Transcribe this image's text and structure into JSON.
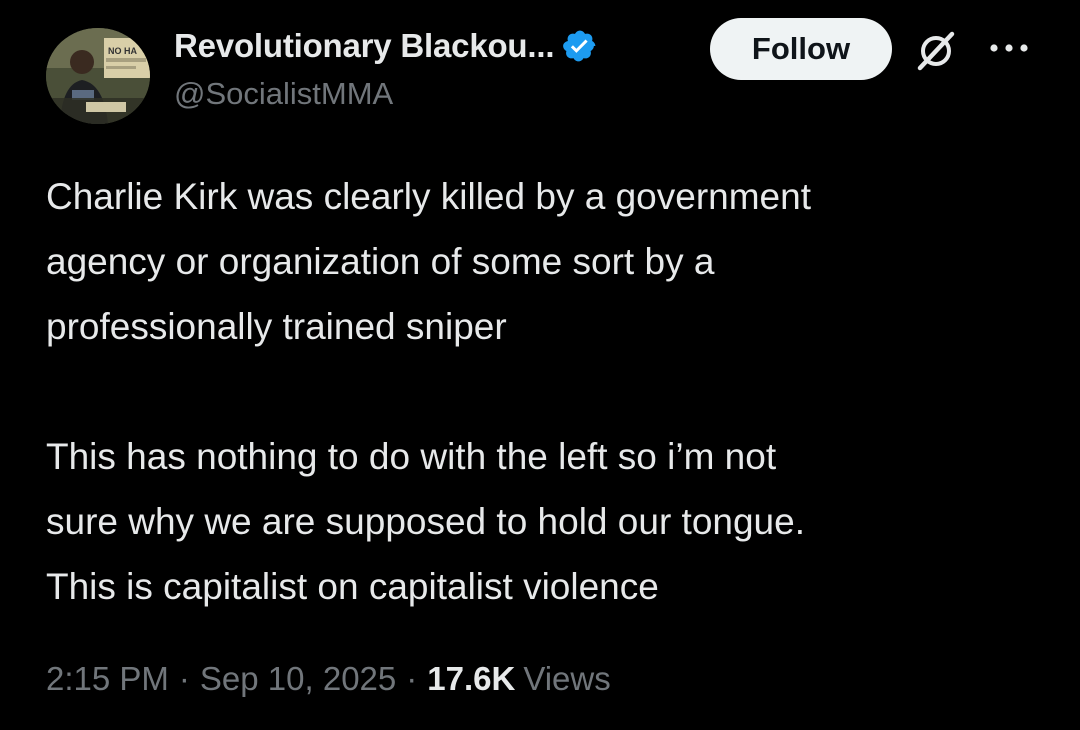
{
  "author": {
    "display_name": "Revolutionary Blackou...",
    "handle": "@SocialistMMA",
    "verified": true,
    "avatar_sign_text": "NO HA"
  },
  "actions": {
    "follow_label": "Follow",
    "grok_icon": "grok-icon",
    "more_icon": "more-icon"
  },
  "tweet": {
    "paragraph_1": "Charlie Kirk was clearly killed by a government\nagency or organization of some sort by a\nprofessionally trained sniper",
    "paragraph_2": "This has nothing to do with the left so i’m not\nsure why we are supposed to hold our tongue.\nThis is capitalist on capitalist violence"
  },
  "meta": {
    "time": "2:15 PM",
    "separator": "·",
    "date": "Sep 10, 2025",
    "views_count": "17.6K",
    "views_label": "Views"
  },
  "colors": {
    "background": "#000000",
    "text_primary": "#e7e9ea",
    "text_secondary": "#71767b",
    "verified_blue": "#1d9bf0",
    "follow_bg": "#eff3f4",
    "follow_text": "#0f1419"
  }
}
